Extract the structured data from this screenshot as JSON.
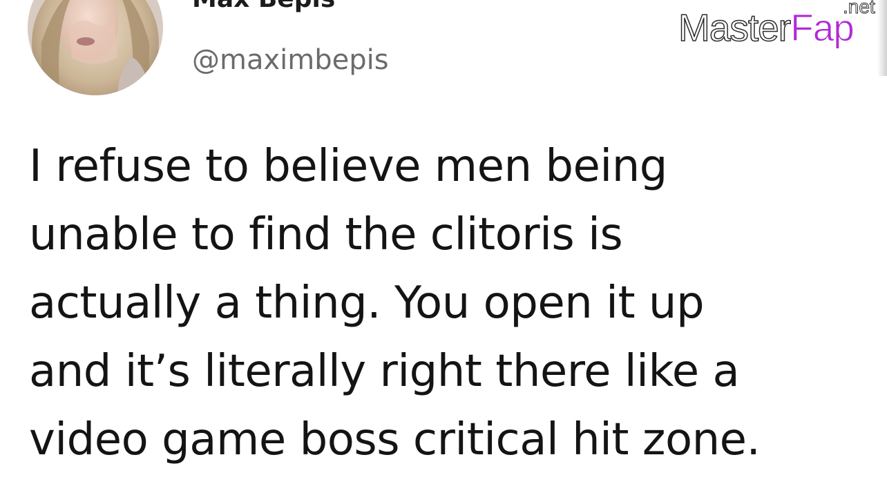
{
  "author": {
    "display_name": "Max Bepis",
    "handle": "@maximbepis",
    "avatar": "profile-photo"
  },
  "tweet": {
    "lines": [
      "I refuse to believe men being",
      "unable to find the clitoris is",
      "actually a thing. You open it up",
      "and it’s literally right there like a",
      "video game boss critical hit zone."
    ]
  },
  "watermark": {
    "part1": "Master",
    "part2": "Fap",
    "suffix": ".net",
    "accent_color": "#b12ad6"
  }
}
